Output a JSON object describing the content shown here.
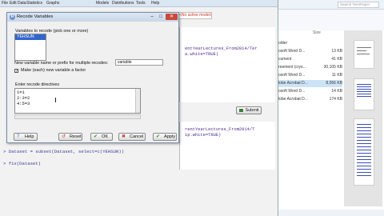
{
  "rcmdr": {
    "menu": [
      "File",
      "Edit",
      "Data",
      "Statistics",
      "Graphs",
      "Models",
      "Distributions",
      "Tools",
      "Help"
    ],
    "active_model": "<No active model>",
    "script_lines": [
      "entYearLectures_From2014/Ter",
      "a.white=TRUE)"
    ],
    "submit_label": "Submit",
    "output_lines": [
      "rentYearLectures_From2014/T",
      "ip.white=TRUE)"
    ],
    "console_lines": [
      "> Dataset = subset(Dataset, select=c(YEHSUN))",
      "",
      "> fix(Dataset)"
    ]
  },
  "explorer": {
    "search_placeholder": "Search TeenPaper",
    "size_header": "Size",
    "files": [
      {
        "name": "older",
        "size": ""
      },
      {
        "name": "osoft Word D...",
        "size": "13 KB"
      },
      {
        "name": "cument",
        "size": "41 KB"
      },
      {
        "name": "reement (crys...",
        "size": "30,105 KB"
      },
      {
        "name": "osoft Word D...",
        "size": "11 KB"
      },
      {
        "name": "lobe Acrobat D...",
        "size": "8,056 KB"
      },
      {
        "name": "osoft Word D...",
        "size": "14 KB"
      },
      {
        "name": "lobe Acrobat D...",
        "size": "174 KB"
      }
    ]
  },
  "dialog": {
    "title": "Recode Variables",
    "vars_label": "Variables to recode (pick one or more)",
    "variables": [
      "YEHSUN"
    ],
    "newvar_label": "New variable name or prefix for multiple recodes:",
    "newvar_value": "variable",
    "factor_label": "Make (each) new variable a factor",
    "factor_checked": "✓",
    "directives_label": "Enter recode directives",
    "directives": [
      "1=1",
      "2:3=2",
      "4:5=3"
    ],
    "buttons": {
      "help": "Help",
      "reset": "Reset",
      "ok": "OK",
      "cancel": "Cancel",
      "apply": "Apply"
    }
  }
}
